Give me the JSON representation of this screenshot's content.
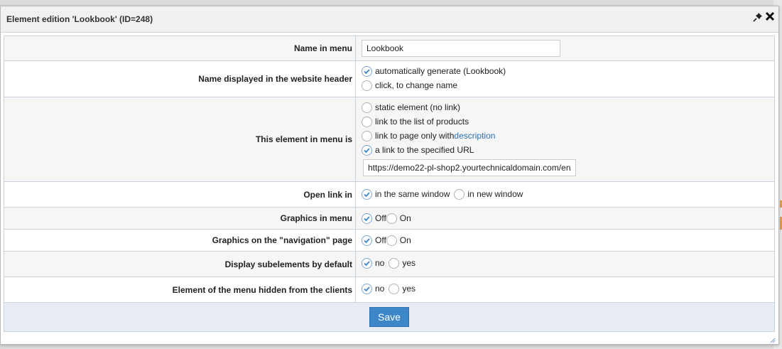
{
  "dialog": {
    "title": "Element edition 'Lookbook' (ID=248)",
    "icons": [
      "pin-icon",
      "close-icon",
      "resize-handle-icon"
    ]
  },
  "fields": {
    "name_in_menu": {
      "label": "Name in menu",
      "value": "Lookbook"
    },
    "header_name": {
      "label": "Name displayed in the website header",
      "options": [
        {
          "label": "automatically generate (Lookbook)",
          "checked": true
        },
        {
          "label": "click, to change name",
          "checked": false
        }
      ]
    },
    "element_type": {
      "label": "This element in menu is",
      "options": [
        {
          "label": "static element (no link)",
          "checked": false
        },
        {
          "label": "link to the list of products",
          "checked": false
        },
        {
          "label": "link to page only with ",
          "link": "description",
          "checked": false
        },
        {
          "label": "a link to the specified URL",
          "checked": true
        }
      ],
      "url_value": "https://demo22-pl-shop2.yourtechnicaldomain.com/en/"
    },
    "open_link": {
      "label": "Open link in",
      "options": [
        {
          "label": "in the same window",
          "checked": true
        },
        {
          "label": "in new window",
          "checked": false
        }
      ]
    },
    "graphics_menu": {
      "label": "Graphics in menu",
      "options": [
        {
          "label": "Off",
          "checked": true
        },
        {
          "label": "On",
          "checked": false
        }
      ]
    },
    "graphics_nav": {
      "label": "Graphics on the \"navigation\" page",
      "options": [
        {
          "label": "Off",
          "checked": true
        },
        {
          "label": "On",
          "checked": false
        }
      ]
    },
    "subelements": {
      "label": "Display subelements by default",
      "options": [
        {
          "label": "no",
          "checked": true
        },
        {
          "label": "yes",
          "checked": false
        }
      ]
    },
    "hidden": {
      "label": "Element of the menu hidden from the clients",
      "options": [
        {
          "label": "no",
          "checked": true
        },
        {
          "label": "yes",
          "checked": false
        }
      ]
    }
  },
  "footer": {
    "save_label": "Save"
  },
  "colors": {
    "accent": "#3d87c8",
    "check": "#3d87c8",
    "link": "#2a6fb5"
  }
}
